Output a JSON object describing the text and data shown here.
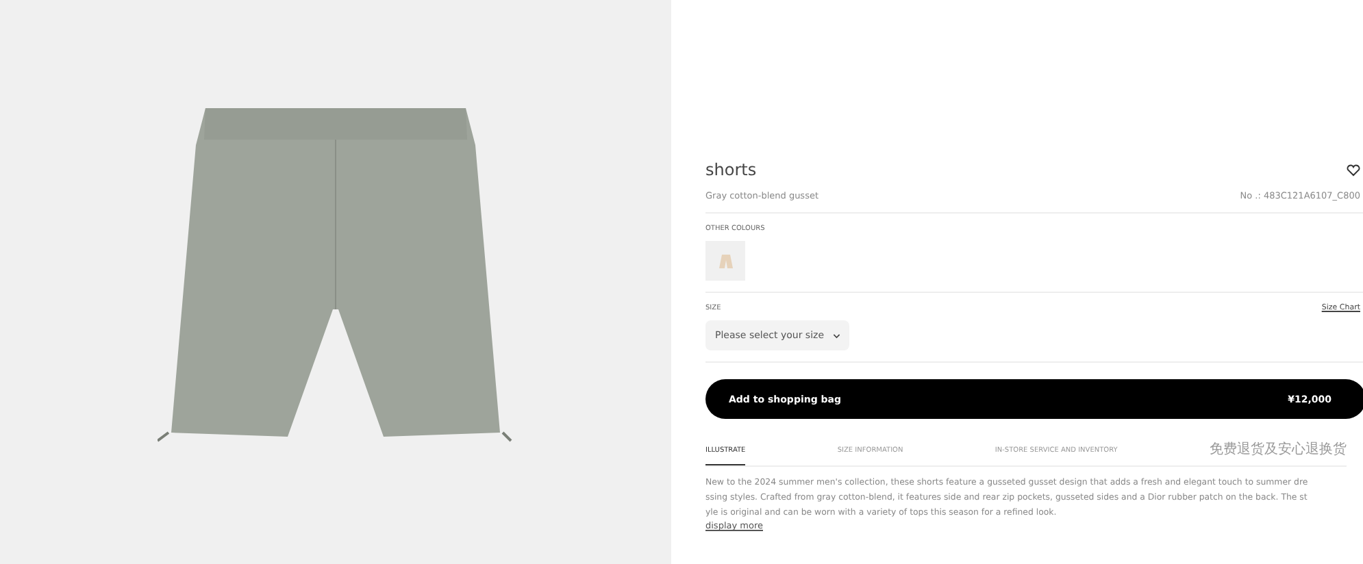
{
  "product": {
    "title": "shorts",
    "subtitle": "Gray cotton-blend gusset",
    "number": "No .: 483C121A6107_C800"
  },
  "colours": {
    "label": "OTHER COLOURS",
    "swatches": [
      {
        "selected": false
      }
    ]
  },
  "size": {
    "label": "SIZE",
    "chart_link": "Size Chart",
    "placeholder": "Please select your size"
  },
  "cart": {
    "label": "Add to shopping bag",
    "price": "¥12,000"
  },
  "tabs": [
    {
      "label": "ILLUSTRATE",
      "selected": true
    },
    {
      "label": "SIZE INFORMATION",
      "selected": false
    },
    {
      "label": "IN-STORE SERVICE AND INVENTORY",
      "selected": false
    },
    {
      "label": "免费退货及安心退换货",
      "selected": false
    }
  ],
  "description": [
    "New to the 2024 summer men's collection, these shorts feature a gusseted gusset design that adds a fresh and elegant touch to summer dre",
    "ssing styles. Crafted from gray cotton-blend, it features side and rear zip pockets, gusseted sides and a Dior rubber patch on the back. The st",
    "yle is original and can be worn with a variety of tops this season for a refined look."
  ],
  "more_link": "display more"
}
